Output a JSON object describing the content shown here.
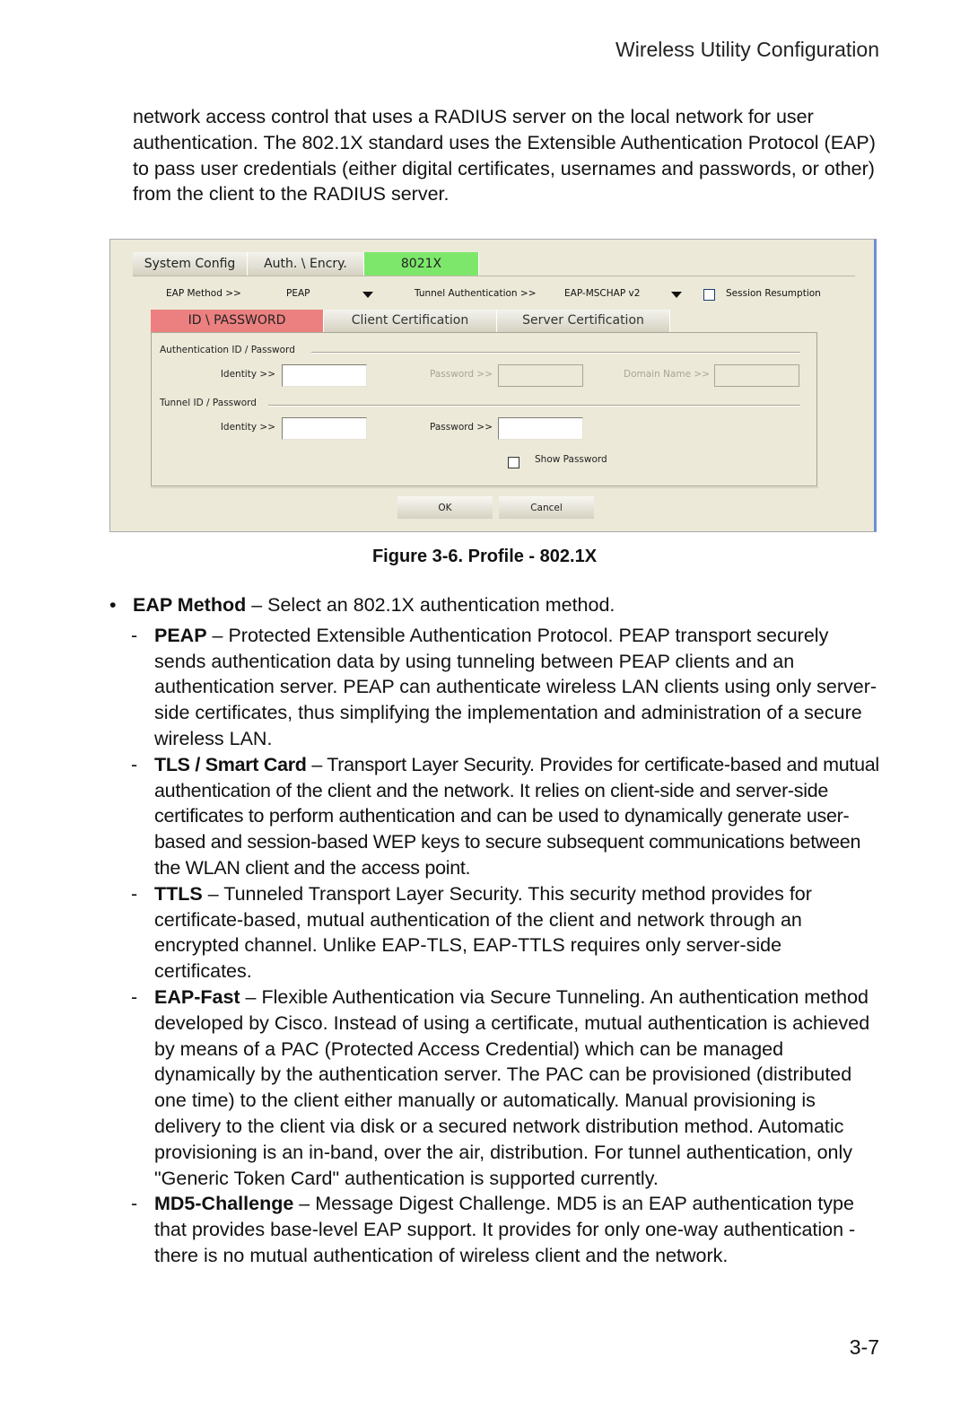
{
  "header": {
    "title": "Wireless Utility Configuration"
  },
  "intro": "network access control that uses a RADIUS server on the local network for user authentication. The 802.1X standard uses the Extensible Authentication Protocol (EAP) to pass user credentials (either digital certificates, usernames and passwords, or other) from the client to the RADIUS server.",
  "dialog": {
    "top_tabs": [
      "System Config",
      "Auth. \\ Encry.",
      "8021X"
    ],
    "active_top_tab": "8021X",
    "eap_method_label": "EAP Method >>",
    "eap_method_value": "PEAP",
    "tunnel_auth_label": "Tunnel Authentication >>",
    "tunnel_auth_value": "EAP-MSCHAP v2",
    "session_resumption_label": "Session Resumption",
    "session_resumption_checked": false,
    "sub_tabs": [
      "ID \\ PASSWORD",
      "Client Certification",
      "Server Certification"
    ],
    "active_sub_tab": "ID \\ PASSWORD",
    "auth_group_label": "Authentication ID / Password",
    "tunnel_group_label": "Tunnel ID / Password",
    "identity_label": "Identity >>",
    "password_label": "Password >>",
    "domain_label": "Domain Name >>",
    "auth_identity_value": "",
    "auth_password_value": "",
    "domain_value": "",
    "tunnel_identity_value": "",
    "tunnel_password_value": "",
    "show_password_label": "Show Password",
    "show_password_checked": false,
    "ok_label": "OK",
    "cancel_label": "Cancel",
    "colors": {
      "active_top_tab": "#7de76b",
      "active_sub_tab": "#ec8080",
      "background": "#ece9d8"
    }
  },
  "caption": "Figure 3-6.  Profile - 802.1X",
  "bullets": [
    {
      "term": "EAP Method",
      "text": " – Select an 802.1X authentication method.",
      "items": [
        {
          "term": "PEAP",
          "text": " – Protected Extensible Authentication Protocol. PEAP transport securely sends authentication data by using tunneling between PEAP clients and an authentication server. PEAP can authenticate wireless LAN clients using only server-side certificates, thus simplifying the implementation and administration of a secure wireless LAN."
        },
        {
          "term": "TLS / Smart Card",
          "text": " – Transport Layer Security. Provides for certificate-based and mutual authentication of the client and the network. It relies on client-side and server-side certificates to perform authentication and can be used to dynamically generate user-based and session-based WEP keys to secure subsequent communications between the WLAN client and the access point."
        },
        {
          "term": "TTLS",
          "text": " – Tunneled Transport Layer Security. This security method provides for certificate-based, mutual authentication of the client and network through an encrypted channel. Unlike EAP-TLS, EAP-TTLS requires only server-side certificates."
        },
        {
          "term": "EAP-Fast",
          "text": " – Flexible Authentication via Secure Tunneling. An authentication method developed by Cisco. Instead of using a certificate, mutual authentication is achieved by means of a PAC (Protected Access Credential) which can be managed dynamically by the authentication server. The PAC can be provisioned (distributed one time) to the client either manually or automatically. Manual provisioning is delivery to the client via disk or a secured network distribution method. Automatic provisioning is an in-band, over the air, distribution. For tunnel authentication, only \"Generic Token Card\" authentication is supported currently."
        },
        {
          "term": "MD5-Challenge",
          "text": " – Message Digest Challenge. MD5 is an EAP authentication type that provides base-level EAP support. It provides for only one-way authentication - there is no mutual authentication of wireless client and the network."
        }
      ]
    }
  ],
  "page_number": "3-7"
}
